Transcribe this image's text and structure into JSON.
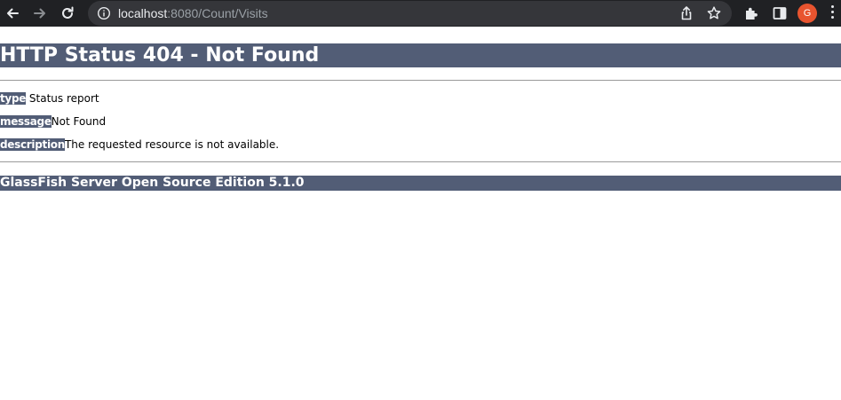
{
  "browser": {
    "url_host": "localhost",
    "url_rest": ":8080/Count/Visits",
    "profile_initial": "G",
    "colors": {
      "toolbar_bg": "#202124",
      "omnibox_bg": "#35363a",
      "avatar_bg": "#e8542f"
    },
    "icons": [
      "back-arrow-icon",
      "forward-arrow-icon",
      "reload-icon",
      "info-icon",
      "share-icon",
      "bookmark-star-icon",
      "extensions-puzzle-icon",
      "side-panel-icon",
      "kebab-menu-icon"
    ]
  },
  "error_page": {
    "title": "HTTP Status 404 - Not Found",
    "rows": [
      {
        "key": "type",
        "value": " Status report"
      },
      {
        "key": "message",
        "value": "Not Found"
      },
      {
        "key": "description",
        "value": "The requested resource is not available."
      }
    ],
    "footer": "GlassFish Server Open Source Edition 5.1.0",
    "colors": {
      "bar_bg": "#525d76",
      "bar_text": "#ffffff",
      "rule": "#9a9a9a"
    }
  }
}
